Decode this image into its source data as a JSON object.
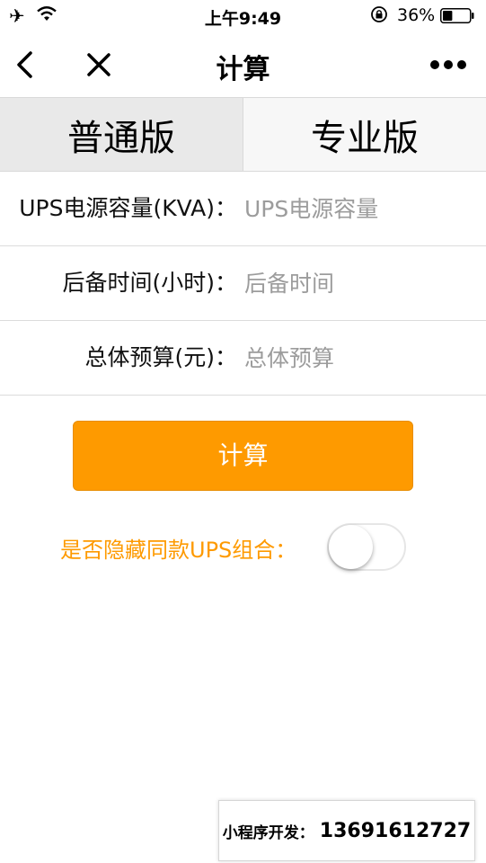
{
  "status_bar": {
    "airplane_icon": "airplane-icon",
    "wifi_icon": "wifi-icon",
    "time": "上午9:49",
    "lock_icon": "rotation-lock-icon",
    "battery_percent": "36%",
    "battery_level": 0.36
  },
  "nav": {
    "title": "计算",
    "back_icon": "chevron-left-icon",
    "close_icon": "close-icon",
    "more_icon": "more-dots-icon"
  },
  "tabs": [
    {
      "label": "普通版",
      "active": true
    },
    {
      "label": "专业版",
      "active": false
    }
  ],
  "form": {
    "fields": [
      {
        "label": "UPS电源容量(KVA)：",
        "placeholder": "UPS电源容量",
        "value": ""
      },
      {
        "label": "后备时间(小时)：",
        "placeholder": "后备时间",
        "value": ""
      },
      {
        "label": "总体预算(元)：",
        "placeholder": "总体预算",
        "value": ""
      }
    ],
    "calculate_label": "计算",
    "toggle_label": "是否隐藏同款UPS组合：",
    "toggle_on": false
  },
  "footer": {
    "dev_label": "小程序开发：",
    "dev_phone": "13691612727"
  },
  "colors": {
    "accent": "#fe9a00",
    "tab_active_bg": "#e9e9e9",
    "placeholder": "#9c9c9c"
  }
}
